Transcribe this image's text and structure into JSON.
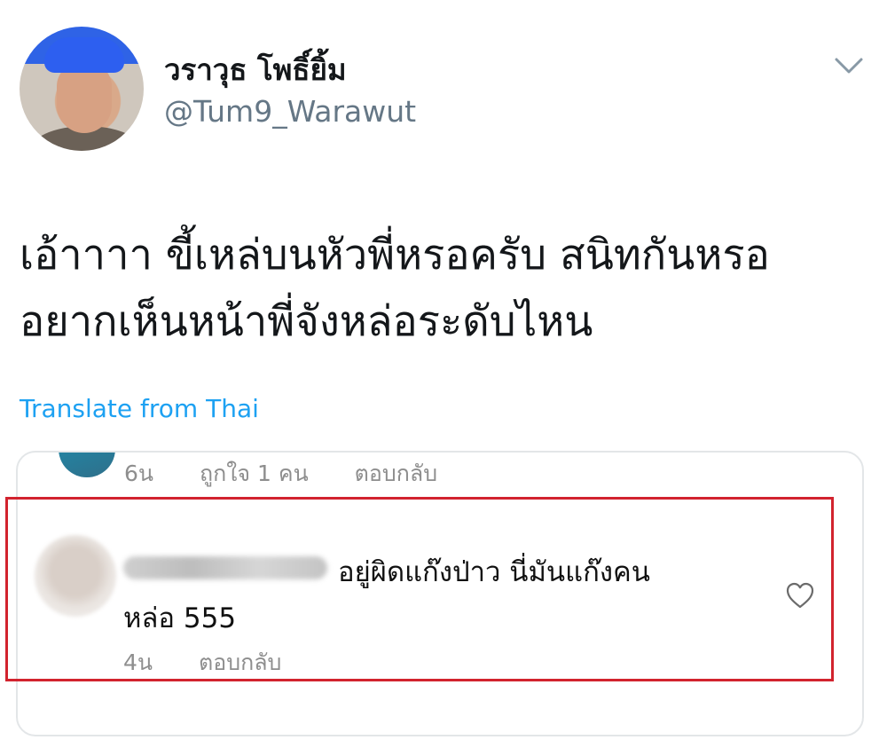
{
  "tweet": {
    "display_name": "วราวุธ โพธิ์ยิ้ม",
    "handle": "@Tum9_Warawut",
    "text": "เอ้าาาา ขี้เหล่บนหัวพี่หรอครับ สนิทกันหรอ อยากเห็นหน้าพี่จังหล่อระดับไหน",
    "translate_label": "Translate from Thai"
  },
  "prev_comment": {
    "time": "6น",
    "likes": "ถูกใจ 1 คน",
    "reply_label": "ตอบกลับ"
  },
  "comment": {
    "text_line1": "อยู่ผิดแก๊งป่าว นี่มันแก๊งคน",
    "text_line2": "หล่อ  555",
    "time": "4น",
    "reply_label": "ตอบกลับ"
  },
  "icons": {
    "menu": "chevron-down-icon",
    "like": "heart-icon"
  },
  "colors": {
    "link": "#1da1f2",
    "highlight_border": "#d2232e",
    "meta_text": "#8e8e8e"
  }
}
